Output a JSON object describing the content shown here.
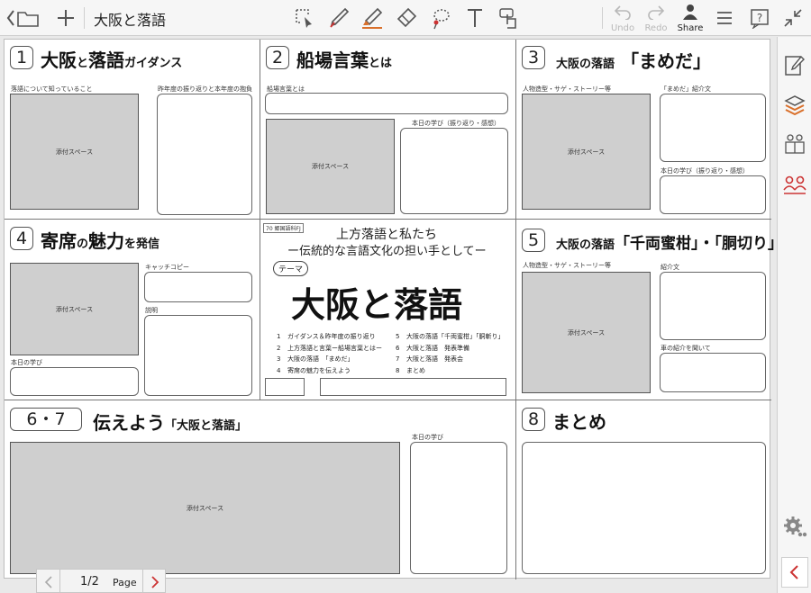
{
  "toolbar": {
    "title": "大阪と落語",
    "undo_label": "Undo",
    "redo_label": "Redo",
    "share_label": "Share",
    "accent_color": "#d9702b",
    "icons": [
      "folder-back-icon",
      "add-icon",
      "lasso-icon",
      "pen-icon",
      "highlighter-icon",
      "eraser-icon",
      "lasso-select-icon",
      "text-icon",
      "touch-icon",
      "undo-icon",
      "redo-icon",
      "share-icon",
      "menu-icon",
      "help-icon",
      "shrink-icon"
    ]
  },
  "sidebar": {
    "icons": [
      "edit-page-icon",
      "layers-icon",
      "group-icon",
      "participants-icon",
      "settings-icon",
      "collapse-icon"
    ]
  },
  "sheet": {
    "cell1": {
      "num": "1",
      "title_a": "大阪",
      "title_b": "と",
      "title_c": "落語",
      "title_d": "ガイダンス",
      "left_caption": "落語について知っていること",
      "right_caption": "昨年度の振り返りと本年度の抱負",
      "attach": "添付スペース"
    },
    "cell2": {
      "num": "2",
      "title_a": "船場言葉",
      "title_b": "とは",
      "caption_top": "船場言葉とは",
      "attach": "添付スペース",
      "right_caption": "本日の学び（振り返り・感想）"
    },
    "cell3": {
      "num": "3",
      "title_a": "大阪の落語",
      "title_b": "「まめだ」",
      "left_caption": "人物造型・サゲ・ストーリー等",
      "right_caption_1": "「まめだ」紹介文",
      "right_caption_2": "本日の学び（振り返り・感想）",
      "attach": "添付スペース"
    },
    "cell4": {
      "num": "4",
      "title_a": "寄席",
      "title_b": "の",
      "title_c": "魅力",
      "title_d": "を発信",
      "caption_catch": "キャッチコピー",
      "caption_desc": "説明",
      "caption_learn": "本日の学び",
      "attach": "添付スペース"
    },
    "center": {
      "badge": "70 郷国語科FJ",
      "line1": "上方落語と私たち",
      "line2": "ー伝統的な言語文化の担い手としてー",
      "theme": "テーマ",
      "main_title": "大阪と落語",
      "toc": [
        {
          "n": "1",
          "t": "ガイダンス＆昨年度の振り返り"
        },
        {
          "n": "2",
          "t": "上方落語と言葉ー船場言葉とはー"
        },
        {
          "n": "3",
          "t": "大阪の落語　「まめだ」"
        },
        {
          "n": "4",
          "t": "寄席の魅力を伝えよう"
        },
        {
          "n": "5",
          "t": "大阪の落語「千両蜜柑」「胴斬り」"
        },
        {
          "n": "6",
          "t": "大阪と落語　発表準備"
        },
        {
          "n": "7",
          "t": "大阪と落語　発表会"
        },
        {
          "n": "8",
          "t": "まとめ"
        }
      ]
    },
    "cell5": {
      "num": "5",
      "title_a": "大阪の落語",
      "title_b": "「千両蜜柑」・「胴切り」",
      "left_caption": "人物造型・サゲ・ストーリー等",
      "right_caption_1": "紹介文",
      "right_caption_2": "車の紹介を聞いて",
      "attach": "添付スペース"
    },
    "cell67": {
      "num": "6・7",
      "title_a": "伝えよう",
      "title_b": "「大阪と落語」",
      "right_caption": "本日の学び",
      "attach": "添付スペース"
    },
    "cell8": {
      "num": "8",
      "title_a": "まとめ"
    }
  },
  "pager": {
    "page_indicator": "1/2",
    "page_label": "Page"
  }
}
